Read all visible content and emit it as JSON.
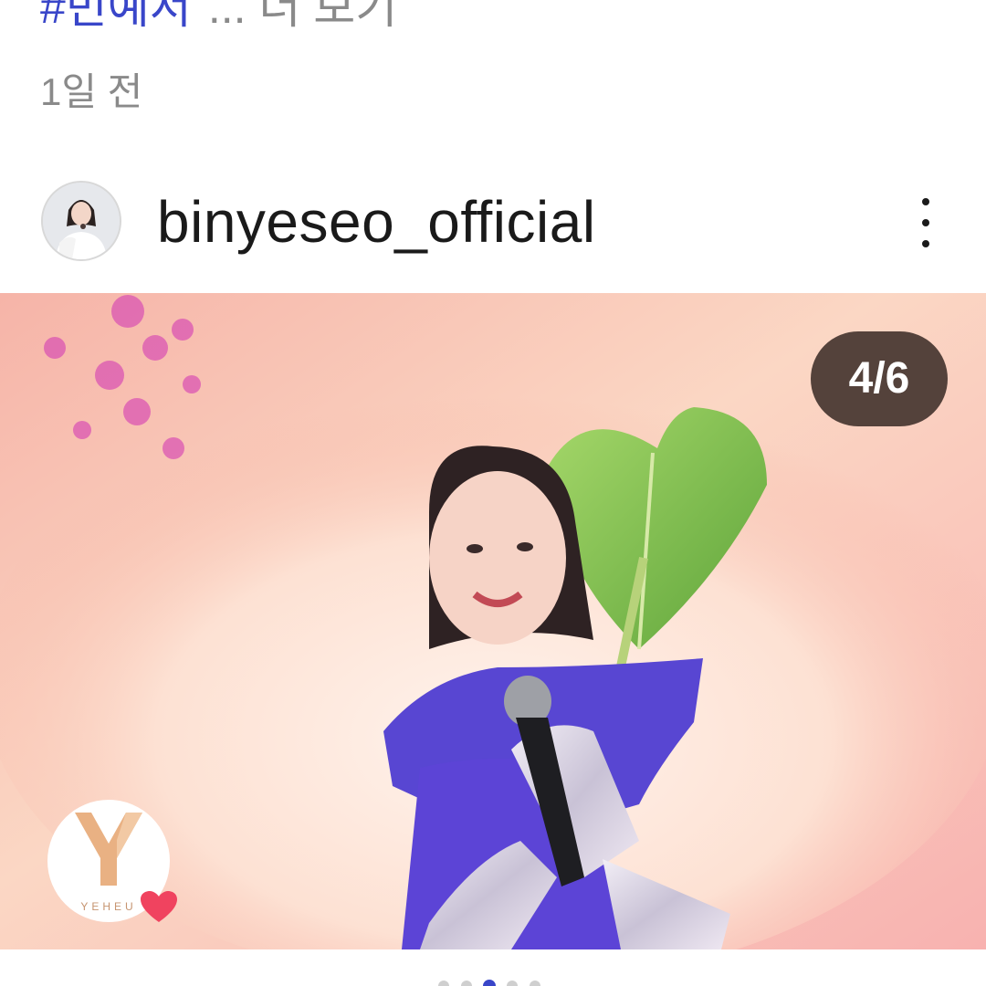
{
  "caption": {
    "hashtag_text": "#빈예서",
    "more_text": "... 더 보기"
  },
  "timestamp": "1일 전",
  "post": {
    "username": "binyeseo_official",
    "counter": "4/6",
    "logo_text": "YEHEU"
  },
  "icons": {
    "menu": "more-vertical-icon",
    "heart": "heart-icon"
  },
  "colors": {
    "hashtag": "#3946c9",
    "muted": "#8a8a8a",
    "counter_bg": "#3c2d28"
  }
}
